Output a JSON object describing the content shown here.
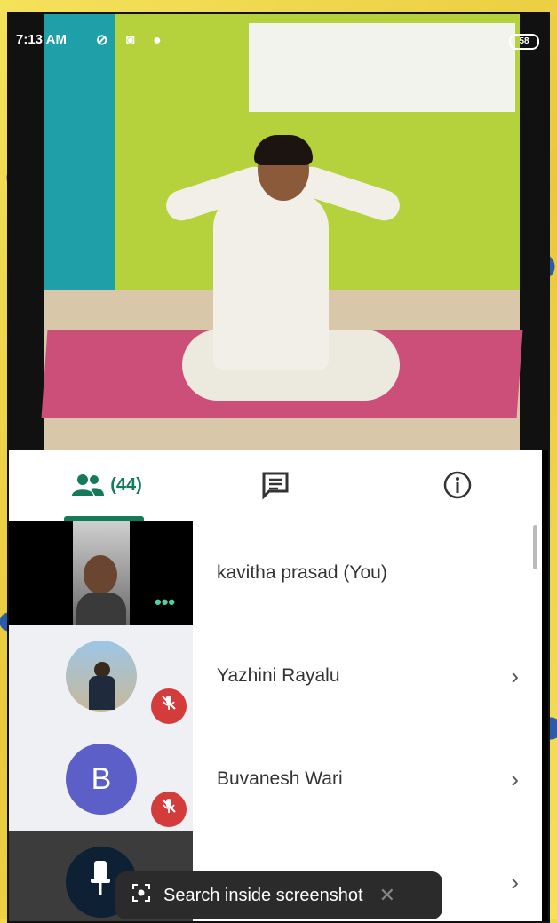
{
  "status_bar": {
    "time": "7:13 AM",
    "battery": "58"
  },
  "tabs": {
    "people_count": "(44)",
    "active": "people"
  },
  "participants": [
    {
      "name": "kavitha prasad (You)",
      "muted": false,
      "avatar_letter": ""
    },
    {
      "name": "Yazhini Rayalu",
      "muted": true,
      "avatar_letter": ""
    },
    {
      "name": "Buvanesh Wari",
      "muted": true,
      "avatar_letter": "B"
    },
    {
      "name": "",
      "muted": false,
      "avatar_letter": ""
    }
  ],
  "toast": {
    "label": "Search inside screenshot"
  },
  "colors": {
    "accent": "#137a5a",
    "mute_red": "#d43b3b",
    "avatar_purple": "#5b5fc7"
  },
  "icons": {
    "people": "people-icon",
    "chat": "chat-icon",
    "info": "info-icon",
    "chevron": "chevron-right-icon",
    "mic_off": "mic-off-icon",
    "more": "more-dots-icon",
    "pin": "pin-icon",
    "search_screenshot": "lens-icon",
    "close": "close-icon"
  }
}
